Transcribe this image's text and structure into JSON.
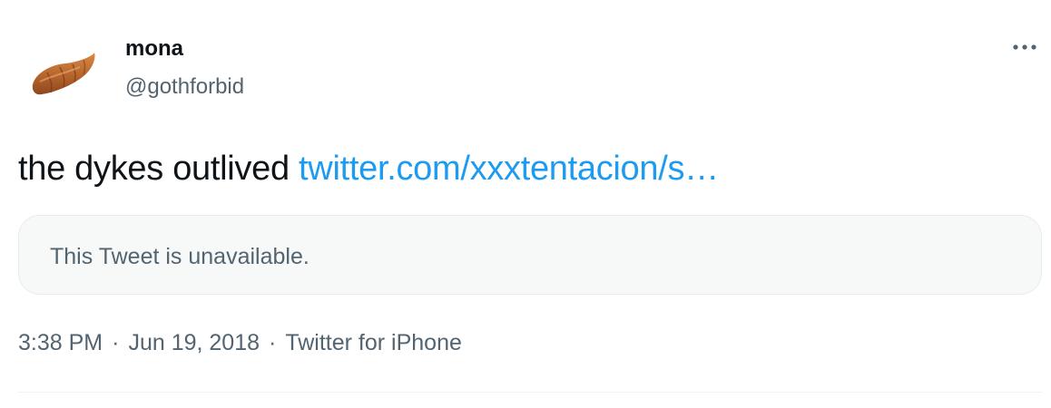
{
  "author": {
    "display_name": "mona",
    "handle": "@gothforbid",
    "avatar_icon": "croissant-icon"
  },
  "tweet": {
    "text": "the dykes outlived ",
    "link_text": "twitter.com/xxxtentacion/s…",
    "quoted_tweet": {
      "message": "This Tweet is unavailable."
    }
  },
  "meta": {
    "time": "3:38 PM",
    "separator": "·",
    "date": "Jun 19, 2018",
    "source": "Twitter for iPhone"
  },
  "icons": {
    "more": "more-options-icon"
  },
  "colors": {
    "text_primary": "#0f1419",
    "text_secondary": "#536471",
    "link": "#1d9bf0",
    "quote_background": "#f7f9f9"
  }
}
